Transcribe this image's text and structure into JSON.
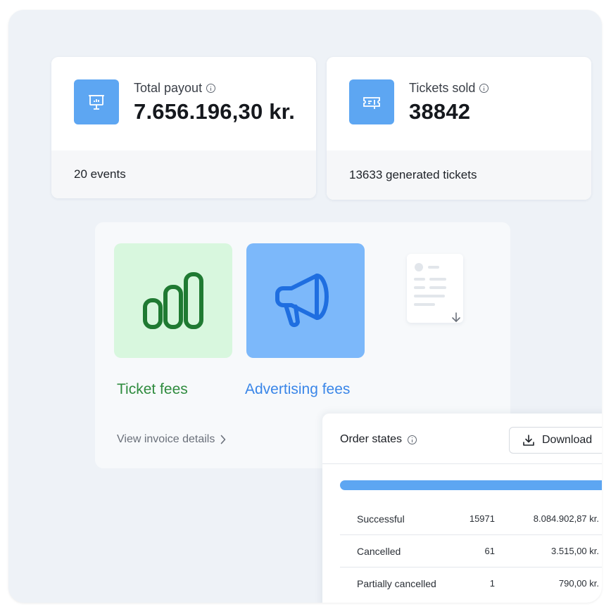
{
  "stats": {
    "payout": {
      "label": "Total payout",
      "value": "7.656.196,30 kr.",
      "footer": "20 events",
      "icon": "presentation-chart-icon"
    },
    "tickets": {
      "label": "Tickets sold",
      "value": "38842",
      "footer": "13633 generated tickets",
      "icon": "ticket-icon"
    }
  },
  "fees": {
    "ticket": {
      "label": "Ticket fees",
      "icon": "bar-chart-icon",
      "color": "#2e8b3e",
      "tile_bg": "#d8f7de"
    },
    "advertising": {
      "label": "Advertising fees",
      "icon": "megaphone-icon",
      "color": "#3a86e8",
      "tile_bg": "#7cb8fa"
    },
    "invoice_link": "View invoice details"
  },
  "orders": {
    "title": "Order states",
    "download_label": "Download",
    "rows": [
      {
        "state": "Successful",
        "count": "15971",
        "amount": "8.084.902,87 kr."
      },
      {
        "state": "Cancelled",
        "count": "61",
        "amount": "3.515,00 kr."
      },
      {
        "state": "Partially cancelled",
        "count": "1",
        "amount": "790,00 kr."
      }
    ]
  },
  "colors": {
    "accent": "#5da6f2",
    "background": "#eef2f7"
  }
}
